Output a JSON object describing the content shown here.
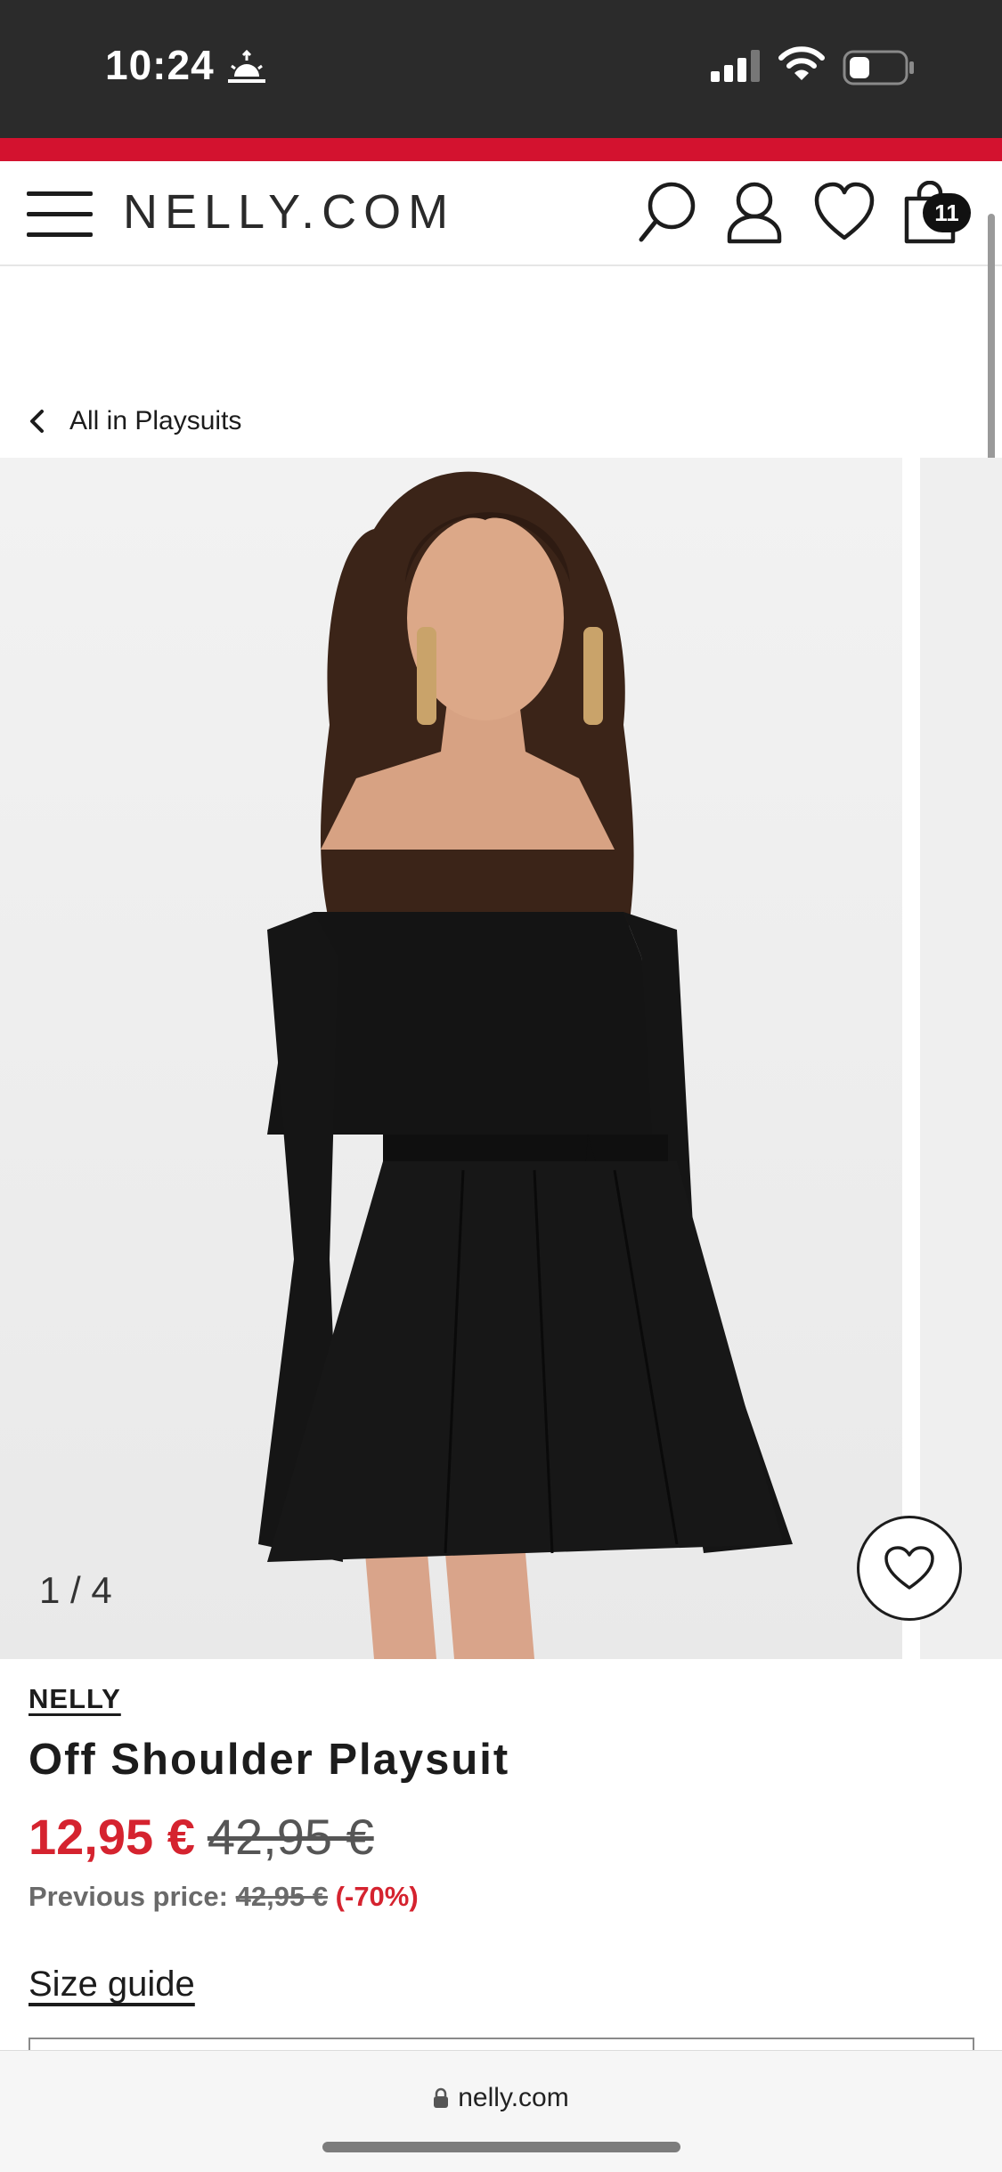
{
  "status_bar": {
    "time": "10:24",
    "icons": [
      "sunrise-icon",
      "signal-icon",
      "wifi-icon",
      "battery-icon"
    ]
  },
  "header": {
    "logo": "NELLY.COM",
    "cart_count": "11",
    "icons": [
      "menu-icon",
      "search-icon",
      "account-icon",
      "wishlist-icon",
      "bag-icon"
    ]
  },
  "nav": {
    "back_label": "All in Playsuits"
  },
  "gallery": {
    "counter": "1 / 4"
  },
  "product": {
    "brand": "NELLY",
    "title": "Off Shoulder Playsuit",
    "price_current": "12,95 €",
    "price_original": "42,95 €",
    "previous_label": "Previous price:",
    "previous_value": "42,95 €",
    "discount": "(-70%)"
  },
  "size_guide": "Size guide",
  "browser": {
    "url": "nelly.com"
  },
  "colors": {
    "accent_red": "#d3122f",
    "sale_red": "#d5232f",
    "status_bg": "#2b2b2b"
  }
}
